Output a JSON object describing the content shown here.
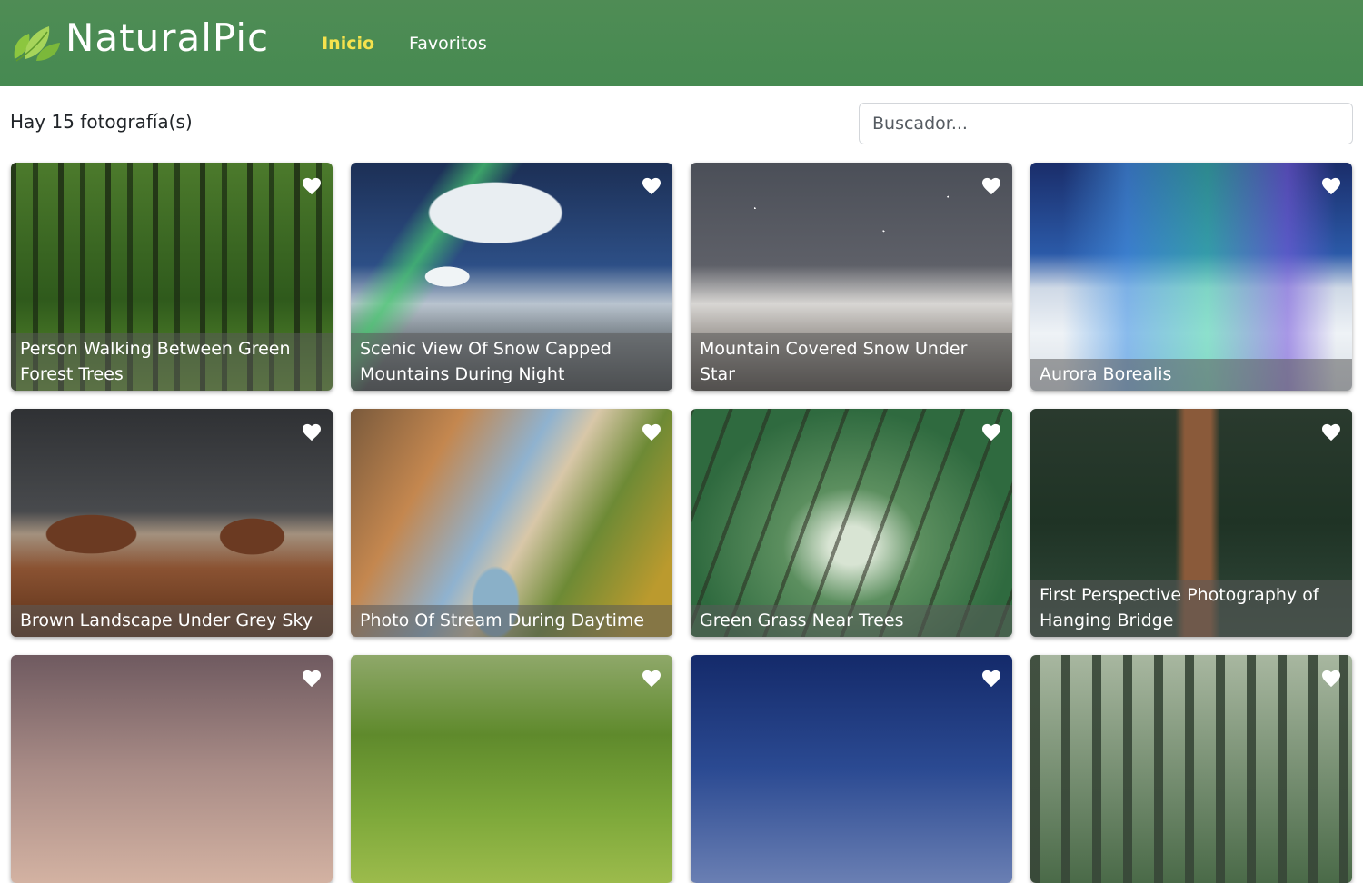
{
  "navbar": {
    "brand": "NaturalPic",
    "links": [
      {
        "label": "Inicio",
        "active": true
      },
      {
        "label": "Favoritos",
        "active": false
      }
    ],
    "background_color": "#4f8c55",
    "active_color": "#f5e24d"
  },
  "main": {
    "counter_text": "Hay 15 fotografía(s)",
    "search_placeholder": "Buscador..."
  },
  "photos": [
    {
      "title": "Person Walking Between Green Forest Trees"
    },
    {
      "title": "Scenic View Of Snow Capped Mountains During Night"
    },
    {
      "title": "Mountain Covered Snow Under Star"
    },
    {
      "title": "Aurora Borealis"
    },
    {
      "title": "Brown Landscape Under Grey Sky"
    },
    {
      "title": "Photo Of Stream During Daytime"
    },
    {
      "title": "Green Grass Near Trees"
    },
    {
      "title": "First Perspective Photography of Hanging Bridge"
    },
    {
      "title": ""
    },
    {
      "title": ""
    },
    {
      "title": ""
    },
    {
      "title": ""
    }
  ],
  "icons": {
    "logo": "leaf-logo-icon",
    "favorite": "heart-icon"
  }
}
